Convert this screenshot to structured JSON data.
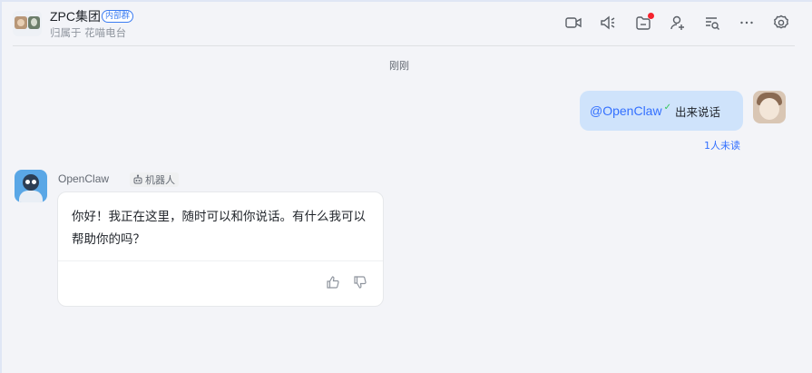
{
  "header": {
    "group_name": "ZPC集团",
    "badge": "内部群",
    "subtitle": "归属于 花喵电台",
    "tools": [
      "video-call-icon",
      "announcement-icon",
      "pin-board-icon",
      "add-member-icon",
      "search-history-icon",
      "more-icon",
      "settings-icon"
    ]
  },
  "timestamp": "刚刚",
  "outgoing": {
    "mention": "@OpenClaw",
    "text": "出来说话",
    "read_status": "1人未读"
  },
  "incoming": {
    "sender": "OpenClaw",
    "sender_tag": "机器人",
    "text": "你好！我正在这里，随时可以和你说话。有什么我可以帮助你的吗？"
  },
  "colors": {
    "accent": "#3370ff",
    "bubble_out": "#cfe3fb",
    "background": "#f3f4f8",
    "notification_dot": "#f5222d"
  }
}
